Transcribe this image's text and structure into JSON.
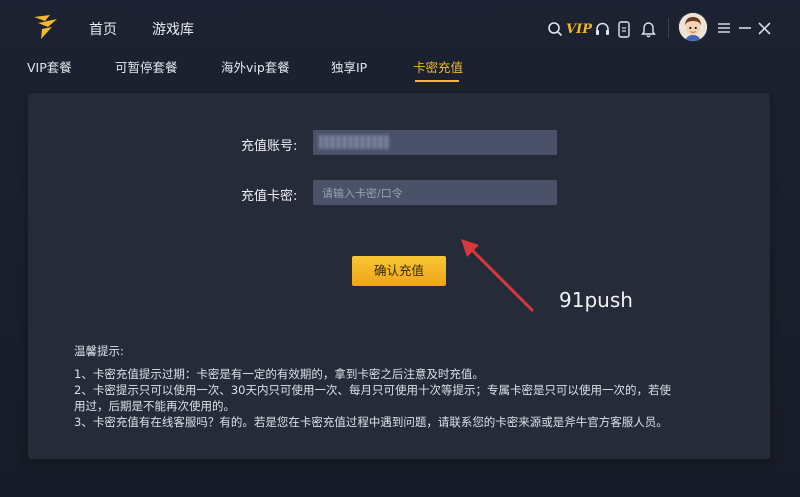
{
  "nav": {
    "home": "首页",
    "games": "游戏库",
    "vip_badge": "VIP"
  },
  "tabs": [
    {
      "label": "VIP套餐"
    },
    {
      "label": "可暂停套餐"
    },
    {
      "label": "海外vip套餐"
    },
    {
      "label": "独享IP"
    },
    {
      "label": "卡密充值",
      "active": true
    }
  ],
  "form": {
    "account_label": "充值账号:",
    "code_label": "充值卡密:",
    "code_placeholder": "请输入卡密/口令",
    "confirm_label": "确认充值"
  },
  "annotation": {
    "text": "91push",
    "arrow_color": "#d6383c"
  },
  "tips": {
    "title": "温馨提示:",
    "lines": [
      "1、卡密充值提示过期：卡密是有一定的有效期的，拿到卡密之后注意及时充值。",
      "2、卡密提示只可以使用一次、30天内只可使用一次、每月只可使用十次等提示；专属卡密是只可以使用一次的，若使",
      "用过，后期是不能再次使用的。",
      "3、卡密充值有在线客服吗？有的。若是您在卡密充值过程中遇到问题，请联系您的卡密来源或是斧牛官方客服人员。"
    ]
  },
  "icons": {
    "search": "search-icon",
    "vip": "vip-icon",
    "headset": "headset-icon",
    "phone": "phone-icon",
    "bell": "bell-icon",
    "menu": "menu-icon",
    "minimize": "minimize-icon",
    "close": "close-icon"
  },
  "colors": {
    "accent": "#f3b82e",
    "panel": "#262b3a",
    "background": "#1b2030"
  }
}
